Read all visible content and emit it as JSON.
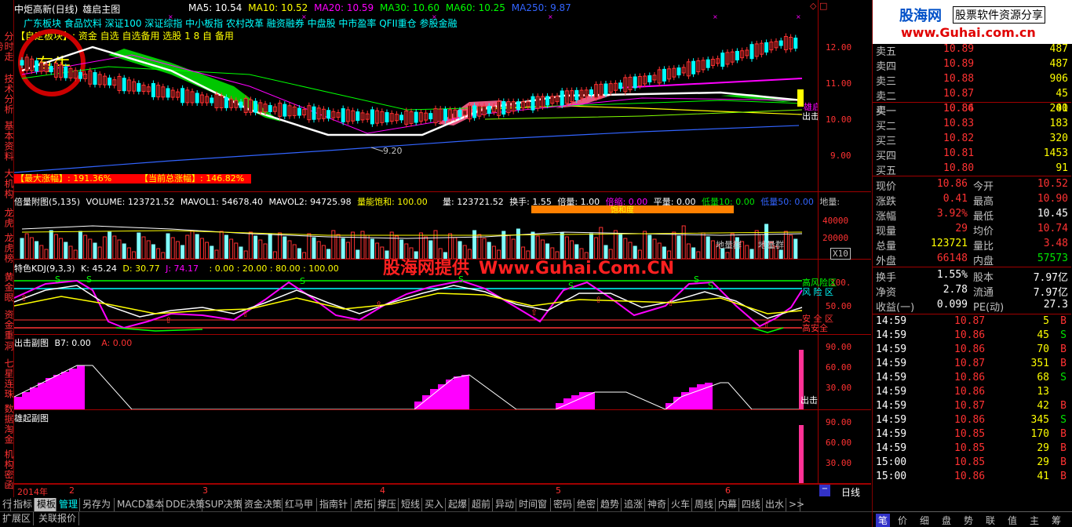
{
  "stock": {
    "name": "中炬高新(日线)",
    "main_indicator": "雄启主图",
    "ma": [
      {
        "label": "MA5: 10.54",
        "color": "#ffffff"
      },
      {
        "label": "MA10: 10.52",
        "color": "#ffff00"
      },
      {
        "label": "MA20: 10.59",
        "color": "#ff00ff"
      },
      {
        "label": "MA30: 10.60",
        "color": "#00ff00"
      },
      {
        "label": "MA60: 10.25",
        "color": "#00ff00"
      },
      {
        "label": "MA250: 9.87",
        "color": "#3264ff"
      }
    ]
  },
  "sectors": {
    "line1": "广东板块 食品饮料 深证100 深证综指 中小板指 农村改革 融资融券 中盘股 中市盈率 QFII重仓 参股金融",
    "line2": "【自定板块】: 资金 自选 自选备用 选股 1 8 自 备用"
  },
  "main_chart": {
    "y_labels": [
      "12.00",
      "11.00",
      "10.00",
      "9.00"
    ],
    "low_label": "9.20",
    "signal_label_1": "雄启",
    "signal_label_2": "出击",
    "rise_text_1": "【最大涨幅】: 191.36%",
    "rise_text_2": "【当前总涨幅】: 146.82%"
  },
  "vol_panel": {
    "title": "倍量附图(5,135)",
    "volume": "VOLUME: 123721.52",
    "mavol1": "MAVOL1: 54678.40",
    "mavol2": "MAVOL2: 94725.98",
    "saturation": "量能饱和: 100.00",
    "liang": "量: 123721.52",
    "turnover": "换手: 1.55",
    "beiliang": "倍量: 1.00",
    "beisuo": "倍缩: 0.00",
    "pingliang": "平量: 0.00",
    "dilianng": "低量10: 0.00",
    "diliang50": "低量50: 0.00",
    "diliang_end": "地量:",
    "y_labels": [
      "40000",
      "20000"
    ],
    "x10": "X10",
    "bar_label": "饱和度",
    "cluster1": "地量群",
    "cluster2": "地量群"
  },
  "kdj_panel": {
    "title": "特色KDJ(9,3,3)",
    "k": "K: 45.24",
    "d": "D: 30.77",
    "j": "J: 74.17",
    "extra": ": 0.00 : 20.00 : 80.00 : 100.00",
    "y_labels": [
      "100.",
      "50.00"
    ],
    "zone_high": "高风险区",
    "zone_risk": "风 险 区",
    "zone_safe": "安 全 区",
    "zone_high_safe": "高安全"
  },
  "sub1_panel": {
    "title": "出击副图",
    "b7": "B7: 0.00",
    "a": "A: 0.00",
    "y_labels": [
      "90.00",
      "60.00",
      "30.00"
    ],
    "signal": "出击"
  },
  "sub2_panel": {
    "title": "雄起副图",
    "y_labels": [
      "90.00",
      "60.00",
      "30.00"
    ]
  },
  "x_axis": {
    "year": "2014年",
    "months": [
      "2",
      "3",
      "4",
      "5",
      "6"
    ],
    "period": "日线"
  },
  "left_tabs": [
    "分时走势",
    "技术分析",
    "基本资料",
    "大机构",
    "龙虎",
    "龙虎榜",
    "黄金眼",
    "资金重",
    "洞",
    "七星连珠",
    "数据淘金",
    "机构密函"
  ],
  "logo": {
    "title": "股海网",
    "subtitle": "股票软件资源分享",
    "url": "www.Guhai.com.cn"
  },
  "watermark": {
    "provider": "股海网提供",
    "url": "Www.Guhai.Com.CN"
  },
  "orderbook": {
    "sell": [
      {
        "label": "卖五",
        "price": "10.89",
        "vol": "487"
      },
      {
        "label": "卖四",
        "price": "10.89",
        "vol": "487"
      },
      {
        "label": "卖三",
        "price": "10.88",
        "vol": "906"
      },
      {
        "label": "卖二",
        "price": "10.87",
        "vol": "45"
      },
      {
        "label": "卖一",
        "price": "10.86",
        "vol": "41"
      }
    ],
    "buy": [
      {
        "label": "买一",
        "price": "10.84",
        "vol": "200"
      },
      {
        "label": "买二",
        "price": "10.83",
        "vol": "183"
      },
      {
        "label": "买三",
        "price": "10.82",
        "vol": "320"
      },
      {
        "label": "买四",
        "price": "10.81",
        "vol": "1453"
      },
      {
        "label": "买五",
        "price": "10.80",
        "vol": "91"
      }
    ]
  },
  "quote": [
    {
      "l1": "现价",
      "v1": "10.86",
      "c1": "#ff3232",
      "l2": "今开",
      "v2": "10.52",
      "c2": "#ff3232"
    },
    {
      "l1": "涨跌",
      "v1": "0.41",
      "c1": "#ff3232",
      "l2": "最高",
      "v2": "10.90",
      "c2": "#ff3232"
    },
    {
      "l1": "涨幅",
      "v1": "3.92%",
      "c1": "#ff3232",
      "l2": "最低",
      "v2": "10.45",
      "c2": "#ffffff"
    },
    {
      "l1": "现量",
      "v1": "29",
      "c1": "#ff3232",
      "l2": "均价",
      "v2": "10.74",
      "c2": "#ff3232"
    },
    {
      "l1": "总量",
      "v1": "123721",
      "c1": "#ffff00",
      "l2": "量比",
      "v2": "3.48",
      "c2": "#ff3232"
    },
    {
      "l1": "外盘",
      "v1": "66148",
      "c1": "#ff3232",
      "l2": "内盘",
      "v2": "57573",
      "c2": "#00e600"
    }
  ],
  "finance": [
    {
      "l1": "换手",
      "v1": "1.55%",
      "l2": "股本",
      "v2": "7.97亿"
    },
    {
      "l1": "净资",
      "v1": "2.78",
      "l2": "流通",
      "v2": "7.97亿"
    },
    {
      "l1": "收益(一)",
      "v1": "0.099",
      "l2": "PE(动)",
      "v2": "27.3"
    }
  ],
  "ticks": [
    {
      "t": "14:59",
      "p": "10.87",
      "v": "5",
      "s": "B"
    },
    {
      "t": "14:59",
      "p": "10.86",
      "v": "45",
      "s": "S"
    },
    {
      "t": "14:59",
      "p": "10.86",
      "v": "70",
      "s": "B"
    },
    {
      "t": "14:59",
      "p": "10.87",
      "v": "351",
      "s": "B"
    },
    {
      "t": "14:59",
      "p": "10.86",
      "v": "68",
      "s": "S"
    },
    {
      "t": "14:59",
      "p": "10.86",
      "v": "13",
      "s": ""
    },
    {
      "t": "14:59",
      "p": "10.87",
      "v": "42",
      "s": "B"
    },
    {
      "t": "14:59",
      "p": "10.86",
      "v": "345",
      "s": "S"
    },
    {
      "t": "14:59",
      "p": "10.85",
      "v": "170",
      "s": "B"
    },
    {
      "t": "14:59",
      "p": "10.85",
      "v": "29",
      "s": "B"
    },
    {
      "t": "15:00",
      "p": "10.85",
      "v": "29",
      "s": "B"
    },
    {
      "t": "15:00",
      "p": "10.86",
      "v": "41",
      "s": "B"
    }
  ],
  "bottom_tabs_row1": [
    "行",
    "指标",
    "模板",
    "管理",
    "另存为",
    "MACD基本",
    "DDE决策",
    "SUP决策",
    "资金决策",
    "红马甲",
    "指南针",
    "虎拓",
    "撑压",
    "短线",
    "买入",
    "起爆",
    "超前",
    "异动",
    "时间窗",
    "密码",
    "绝密",
    "趋势",
    "追涨",
    "神奇",
    "火车",
    "周线",
    "内幕",
    "四线",
    "出水",
    ">>"
  ],
  "bottom_tabs_row2": [
    "扩展区",
    "关联报价"
  ],
  "right_tabs": [
    "笔",
    "价",
    "细",
    "盘",
    "势",
    "联",
    "值",
    "主",
    "筹"
  ]
}
